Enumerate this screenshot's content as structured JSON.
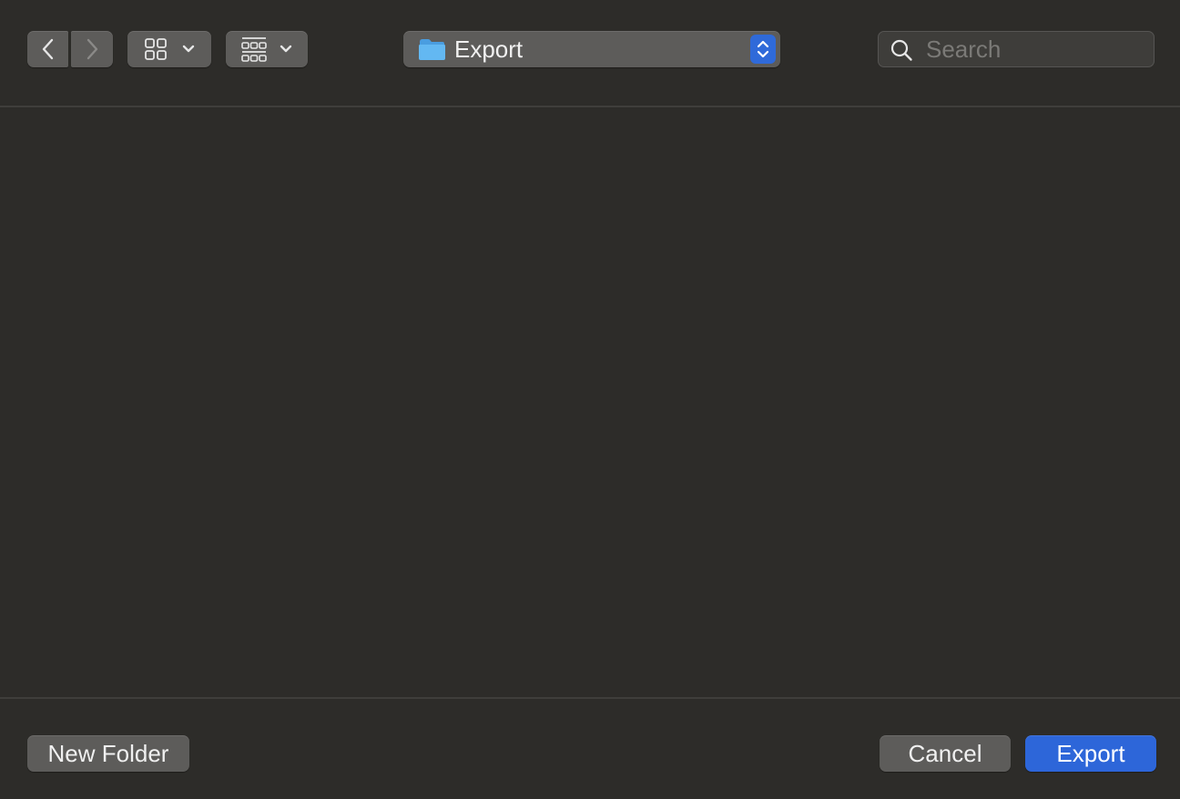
{
  "toolbar": {
    "back_icon": "chevron-left-icon",
    "forward_icon": "chevron-right-icon",
    "icon_view_icon": "icon-grid-icon",
    "group_view_icon": "group-grid-icon",
    "location": {
      "icon": "folder-icon",
      "label": "Export",
      "stepper_icon": "up-down-chevrons-icon"
    },
    "search": {
      "icon": "search-icon",
      "placeholder": "Search",
      "value": ""
    }
  },
  "footer": {
    "new_folder_label": "New Folder",
    "cancel_label": "Cancel",
    "export_label": "Export"
  },
  "colors": {
    "background": "#2d2c29",
    "button": "#5d5c5a",
    "accent": "#2d66d9",
    "folder": "#5fb3ef"
  }
}
